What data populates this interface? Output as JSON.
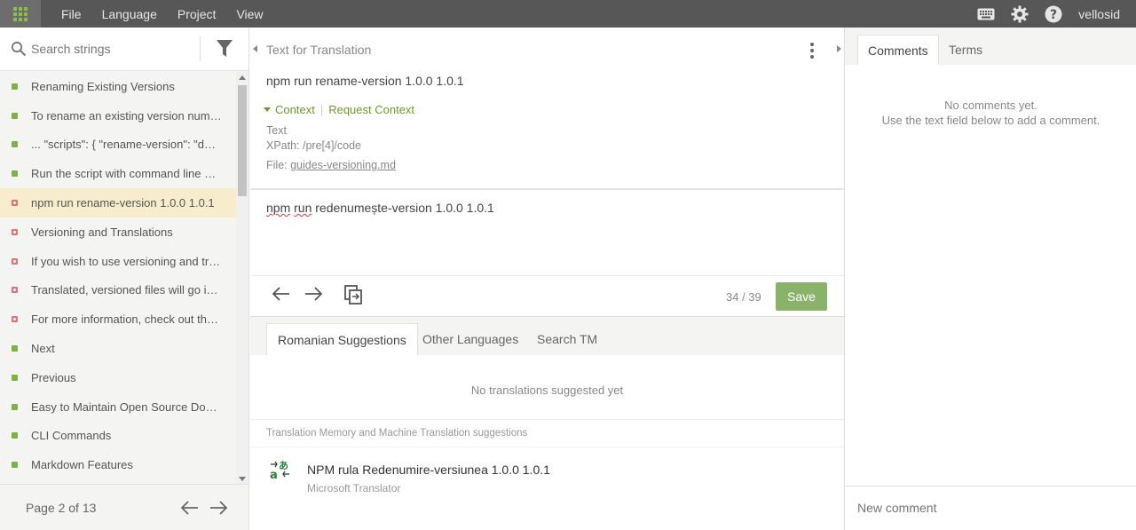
{
  "topbar": {
    "menu": [
      "File",
      "Language",
      "Project",
      "View"
    ],
    "username": "vellosid",
    "icons": [
      "apps-icon",
      "keyboard-icon",
      "gear-icon",
      "help-icon"
    ]
  },
  "left": {
    "search_placeholder": "Search strings",
    "strings": [
      {
        "text": "Renaming Existing Versions",
        "status": "done"
      },
      {
        "text": "To rename an existing version numb...",
        "status": "done"
      },
      {
        "text": "... \"scripts\": { \"rename-version\": \"doc...",
        "status": "done"
      },
      {
        "text": "Run the script with command line ar...",
        "status": "done"
      },
      {
        "text": "npm run rename-version 1.0.0 1.0.1",
        "status": "todo"
      },
      {
        "text": "Versioning and Translations",
        "status": "todo"
      },
      {
        "text": "If you wish to use versioning and tra...",
        "status": "todo"
      },
      {
        "text": "Translated, versioned files will go int...",
        "status": "todo"
      },
      {
        "text": "For more information, check out the ...",
        "status": "todo"
      },
      {
        "text": "Next",
        "status": "done"
      },
      {
        "text": "Previous",
        "status": "done"
      },
      {
        "text": "Easy to Maintain Open Source Docu...",
        "status": "done"
      },
      {
        "text": "CLI Commands",
        "status": "done"
      },
      {
        "text": "Markdown Features",
        "status": "done"
      }
    ],
    "active_index": 4,
    "page_label": "Page 2 of 13"
  },
  "source": {
    "header": "Text for Translation",
    "text": "npm run rename-version 1.0.0 1.0.1",
    "context_label": "Context",
    "request_context": "Request Context",
    "meta_type": "Text",
    "xpath": "XPath: /pre[4]/code",
    "file_prefix": "File: ",
    "file_name": "guides-versioning.md"
  },
  "translation": {
    "word1": "npm",
    "word2": "run",
    "rest": "redenumește-version 1.0.0 1.0.1",
    "counter": "34 / 39",
    "save_label": "Save"
  },
  "suggestions": {
    "tabs": [
      "Romanian Suggestions",
      "Other Languages",
      "Search TM"
    ],
    "empty_text": "No translations suggested yet",
    "tm_title": "Translation Memory and Machine Translation suggestions",
    "mt_text": "NPM rula Redenumire-versiunea 1.0.0 1.0.1",
    "mt_source": "Microsoft Translator"
  },
  "comments": {
    "tabs": [
      "Comments",
      "Terms"
    ],
    "empty_line1": "No comments yet.",
    "empty_line2": "Use the text field below to add a comment.",
    "placeholder": "New comment"
  },
  "colors": {
    "accent_green": "#8bb26a",
    "done": "#7cb342",
    "todo": "#e57373",
    "topbar": "#575757"
  }
}
